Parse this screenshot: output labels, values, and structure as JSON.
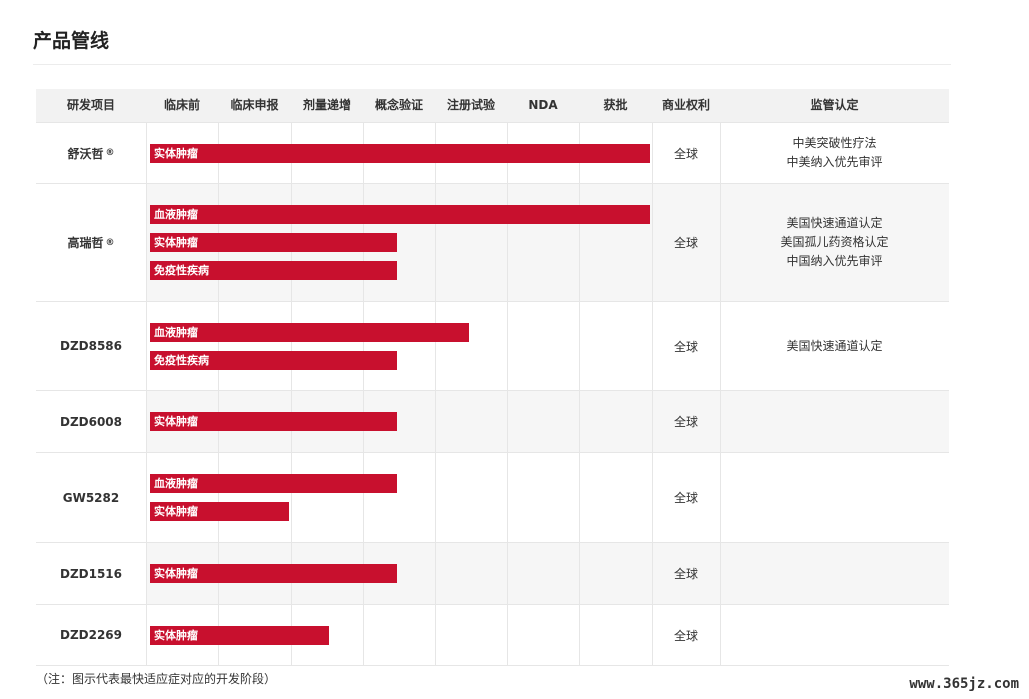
{
  "title": "产品管线",
  "columns": {
    "project": "研发项目",
    "stages": [
      "临床前",
      "临床申报",
      "剂量递增",
      "概念验证",
      "注册试验",
      "NDA",
      "获批"
    ],
    "rights": "商业权利",
    "regulatory": "监管认定"
  },
  "rows": [
    {
      "name": "舒沃哲",
      "reg_mark": "®",
      "bars": [
        {
          "label": "实体肿瘤",
          "progress": 7
        }
      ],
      "rights": "全球",
      "regulatory": [
        "中美突破性疗法",
        "中美纳入优先审评"
      ]
    },
    {
      "name": "高瑞哲",
      "reg_mark": "®",
      "bars": [
        {
          "label": "血液肿瘤",
          "progress": 7
        },
        {
          "label": "实体肿瘤",
          "progress": 3.5
        },
        {
          "label": "免疫性疾病",
          "progress": 3.5
        }
      ],
      "rights": "全球",
      "regulatory": [
        "美国快速通道认定",
        "美国孤儿药资格认定",
        "中国纳入优先审评"
      ]
    },
    {
      "name": "DZD8586",
      "reg_mark": "",
      "bars": [
        {
          "label": "血液肿瘤",
          "progress": 4.5
        },
        {
          "label": "免疫性疾病",
          "progress": 3.5
        }
      ],
      "rights": "全球",
      "regulatory": [
        "美国快速通道认定"
      ]
    },
    {
      "name": "DZD6008",
      "reg_mark": "",
      "bars": [
        {
          "label": "实体肿瘤",
          "progress": 3.5
        }
      ],
      "rights": "全球",
      "regulatory": []
    },
    {
      "name": "GW5282",
      "reg_mark": "",
      "bars": [
        {
          "label": "血液肿瘤",
          "progress": 3.5
        },
        {
          "label": "实体肿瘤",
          "progress": 2
        }
      ],
      "rights": "全球",
      "regulatory": []
    },
    {
      "name": "DZD1516",
      "reg_mark": "",
      "bars": [
        {
          "label": "实体肿瘤",
          "progress": 3.5
        }
      ],
      "rights": "全球",
      "regulatory": []
    },
    {
      "name": "DZD2269",
      "reg_mark": "",
      "bars": [
        {
          "label": "实体肿瘤",
          "progress": 2.55
        }
      ],
      "rights": "全球",
      "regulatory": []
    }
  ],
  "note": "（注：图示代表最快适应症对应的开发阶段）",
  "watermark": "www.365jz.com",
  "colors": {
    "bar": "#c8102e",
    "header_bg": "#f2f2f2",
    "row_shade": "#f6f6f6"
  }
}
